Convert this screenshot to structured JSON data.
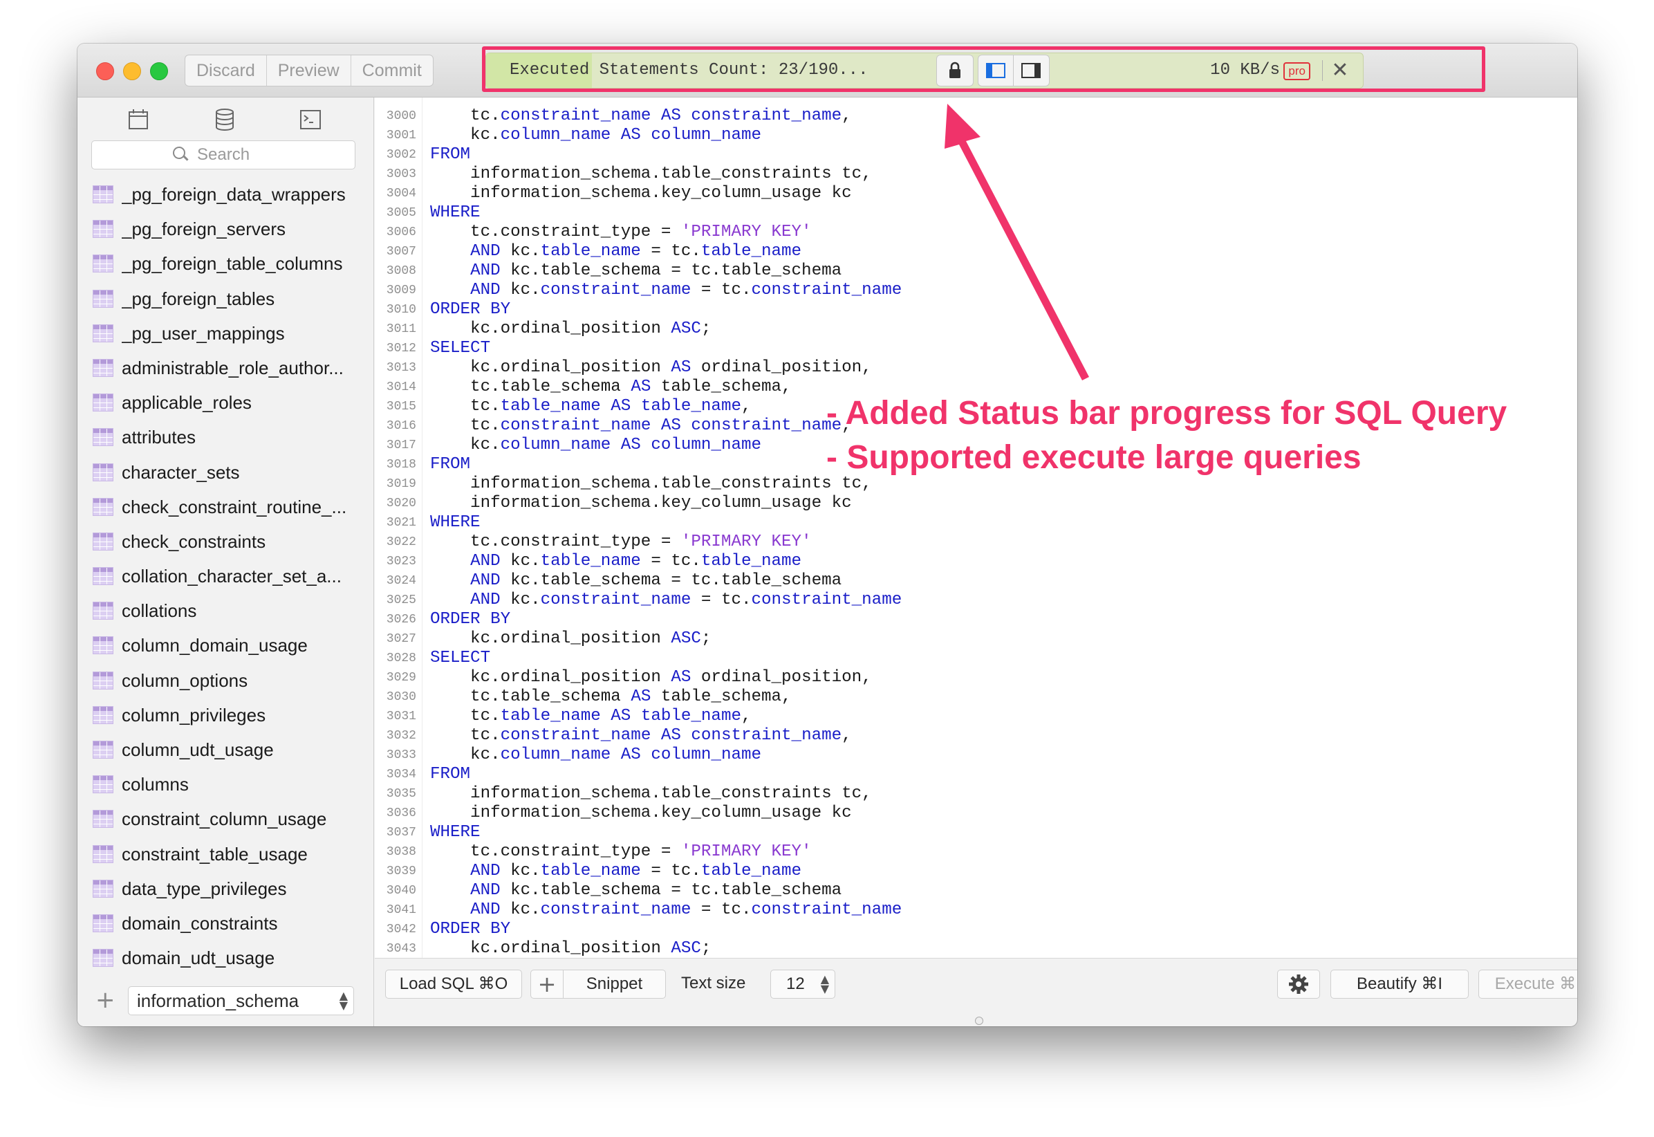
{
  "toolbar": {
    "discard_label": "Discard",
    "preview_label": "Preview",
    "commit_label": "Commit"
  },
  "status_bar": {
    "text": "Executed Statements Count: 23/190...",
    "speed": "10 KB/s",
    "badge": "pro",
    "progress_fraction": 0.121
  },
  "colors": {
    "close": "#fc5f57",
    "minimize": "#fdbc2e",
    "zoom": "#28c840",
    "annotation": "#f0336a",
    "keyword": "#1a1ec8",
    "string": "#8a3ad0"
  },
  "sidebar": {
    "search_placeholder": "Search",
    "tables": [
      "_pg_foreign_data_wrappers",
      "_pg_foreign_servers",
      "_pg_foreign_table_columns",
      "_pg_foreign_tables",
      "_pg_user_mappings",
      "administrable_role_author...",
      "applicable_roles",
      "attributes",
      "character_sets",
      "check_constraint_routine_...",
      "check_constraints",
      "collation_character_set_a...",
      "collations",
      "column_domain_usage",
      "column_options",
      "column_privileges",
      "column_udt_usage",
      "columns",
      "constraint_column_usage",
      "constraint_table_usage",
      "data_type_privileges",
      "domain_constraints",
      "domain_udt_usage"
    ],
    "add_symbol": "+",
    "schema": "information_schema"
  },
  "editor": {
    "lines": [
      {
        "n": "3000",
        "t": [
          [
            "    tc.",
            ""
          ],
          [
            "constraint_name",
            "fld"
          ],
          [
            " ",
            ""
          ],
          [
            "AS",
            "kw"
          ],
          [
            " ",
            ""
          ],
          [
            "constraint_name",
            "fld"
          ],
          [
            ",",
            ""
          ]
        ]
      },
      {
        "n": "3001",
        "t": [
          [
            "    kc.",
            ""
          ],
          [
            "column_name",
            "fld"
          ],
          [
            " ",
            ""
          ],
          [
            "AS",
            "kw"
          ],
          [
            " ",
            ""
          ],
          [
            "column_name",
            "fld"
          ]
        ]
      },
      {
        "n": "3002",
        "t": [
          [
            "FROM",
            "kw"
          ]
        ]
      },
      {
        "n": "3003",
        "t": [
          [
            "    information_schema.table_constraints tc,",
            ""
          ]
        ]
      },
      {
        "n": "3004",
        "t": [
          [
            "    information_schema.key_column_usage kc",
            ""
          ]
        ]
      },
      {
        "n": "3005",
        "t": [
          [
            "WHERE",
            "kw"
          ]
        ]
      },
      {
        "n": "3006",
        "t": [
          [
            "    tc.constraint_type = ",
            ""
          ],
          [
            "'PRIMARY KEY'",
            "str"
          ]
        ]
      },
      {
        "n": "3007",
        "t": [
          [
            "    ",
            ""
          ],
          [
            "AND",
            "kw"
          ],
          [
            " kc.",
            ""
          ],
          [
            "table_name",
            "fld"
          ],
          [
            " = tc.",
            ""
          ],
          [
            "table_name",
            "fld"
          ]
        ]
      },
      {
        "n": "3008",
        "t": [
          [
            "    ",
            ""
          ],
          [
            "AND",
            "kw"
          ],
          [
            " kc.table_schema = tc.table_schema",
            ""
          ]
        ]
      },
      {
        "n": "3009",
        "t": [
          [
            "    ",
            ""
          ],
          [
            "AND",
            "kw"
          ],
          [
            " kc.",
            ""
          ],
          [
            "constraint_name",
            "fld"
          ],
          [
            " = tc.",
            ""
          ],
          [
            "constraint_name",
            "fld"
          ]
        ]
      },
      {
        "n": "3010",
        "t": [
          [
            "ORDER BY",
            "kw"
          ]
        ]
      },
      {
        "n": "3011",
        "t": [
          [
            "    kc.ordinal_position ",
            ""
          ],
          [
            "ASC",
            "kw"
          ],
          [
            ";",
            ""
          ]
        ]
      },
      {
        "n": "3012",
        "t": [
          [
            "SELECT",
            "kw"
          ]
        ]
      },
      {
        "n": "3013",
        "t": [
          [
            "    kc.ordinal_position ",
            ""
          ],
          [
            "AS",
            "kw"
          ],
          [
            " ordinal_position,",
            ""
          ]
        ]
      },
      {
        "n": "3014",
        "t": [
          [
            "    tc.table_schema ",
            ""
          ],
          [
            "AS",
            "kw"
          ],
          [
            " table_schema,",
            ""
          ]
        ]
      },
      {
        "n": "3015",
        "t": [
          [
            "    tc.",
            ""
          ],
          [
            "table_name",
            "fld"
          ],
          [
            " ",
            ""
          ],
          [
            "AS",
            "kw"
          ],
          [
            " ",
            ""
          ],
          [
            "table_name",
            "fld"
          ],
          [
            ",",
            ""
          ]
        ]
      },
      {
        "n": "3016",
        "t": [
          [
            "    tc.",
            ""
          ],
          [
            "constraint_name",
            "fld"
          ],
          [
            " ",
            ""
          ],
          [
            "AS",
            "kw"
          ],
          [
            " ",
            ""
          ],
          [
            "constraint_name",
            "fld"
          ],
          [
            ",",
            ""
          ]
        ]
      },
      {
        "n": "3017",
        "t": [
          [
            "    kc.",
            ""
          ],
          [
            "column_name",
            "fld"
          ],
          [
            " ",
            ""
          ],
          [
            "AS",
            "kw"
          ],
          [
            " ",
            ""
          ],
          [
            "column_name",
            "fld"
          ]
        ]
      },
      {
        "n": "3018",
        "t": [
          [
            "FROM",
            "kw"
          ]
        ]
      },
      {
        "n": "3019",
        "t": [
          [
            "    information_schema.table_constraints tc,",
            ""
          ]
        ]
      },
      {
        "n": "3020",
        "t": [
          [
            "    information_schema.key_column_usage kc",
            ""
          ]
        ]
      },
      {
        "n": "3021",
        "t": [
          [
            "WHERE",
            "kw"
          ]
        ]
      },
      {
        "n": "3022",
        "t": [
          [
            "    tc.constraint_type = ",
            ""
          ],
          [
            "'PRIMARY KEY'",
            "str"
          ]
        ]
      },
      {
        "n": "3023",
        "t": [
          [
            "    ",
            ""
          ],
          [
            "AND",
            "kw"
          ],
          [
            " kc.",
            ""
          ],
          [
            "table_name",
            "fld"
          ],
          [
            " = tc.",
            ""
          ],
          [
            "table_name",
            "fld"
          ]
        ]
      },
      {
        "n": "3024",
        "t": [
          [
            "    ",
            ""
          ],
          [
            "AND",
            "kw"
          ],
          [
            " kc.table_schema = tc.table_schema",
            ""
          ]
        ]
      },
      {
        "n": "3025",
        "t": [
          [
            "    ",
            ""
          ],
          [
            "AND",
            "kw"
          ],
          [
            " kc.",
            ""
          ],
          [
            "constraint_name",
            "fld"
          ],
          [
            " = tc.",
            ""
          ],
          [
            "constraint_name",
            "fld"
          ]
        ]
      },
      {
        "n": "3026",
        "t": [
          [
            "ORDER BY",
            "kw"
          ]
        ]
      },
      {
        "n": "3027",
        "t": [
          [
            "    kc.ordinal_position ",
            ""
          ],
          [
            "ASC",
            "kw"
          ],
          [
            ";",
            ""
          ]
        ]
      },
      {
        "n": "3028",
        "t": [
          [
            "SELECT",
            "kw"
          ]
        ]
      },
      {
        "n": "3029",
        "t": [
          [
            "    kc.ordinal_position ",
            ""
          ],
          [
            "AS",
            "kw"
          ],
          [
            " ordinal_position,",
            ""
          ]
        ]
      },
      {
        "n": "3030",
        "t": [
          [
            "    tc.table_schema ",
            ""
          ],
          [
            "AS",
            "kw"
          ],
          [
            " table_schema,",
            ""
          ]
        ]
      },
      {
        "n": "3031",
        "t": [
          [
            "    tc.",
            ""
          ],
          [
            "table_name",
            "fld"
          ],
          [
            " ",
            ""
          ],
          [
            "AS",
            "kw"
          ],
          [
            " ",
            ""
          ],
          [
            "table_name",
            "fld"
          ],
          [
            ",",
            ""
          ]
        ]
      },
      {
        "n": "3032",
        "t": [
          [
            "    tc.",
            ""
          ],
          [
            "constraint_name",
            "fld"
          ],
          [
            " ",
            ""
          ],
          [
            "AS",
            "kw"
          ],
          [
            " ",
            ""
          ],
          [
            "constraint_name",
            "fld"
          ],
          [
            ",",
            ""
          ]
        ]
      },
      {
        "n": "3033",
        "t": [
          [
            "    kc.",
            ""
          ],
          [
            "column_name",
            "fld"
          ],
          [
            " ",
            ""
          ],
          [
            "AS",
            "kw"
          ],
          [
            " ",
            ""
          ],
          [
            "column_name",
            "fld"
          ]
        ]
      },
      {
        "n": "3034",
        "t": [
          [
            "FROM",
            "kw"
          ]
        ]
      },
      {
        "n": "3035",
        "t": [
          [
            "    information_schema.table_constraints tc,",
            ""
          ]
        ]
      },
      {
        "n": "3036",
        "t": [
          [
            "    information_schema.key_column_usage kc",
            ""
          ]
        ]
      },
      {
        "n": "3037",
        "t": [
          [
            "WHERE",
            "kw"
          ]
        ]
      },
      {
        "n": "3038",
        "t": [
          [
            "    tc.constraint_type = ",
            ""
          ],
          [
            "'PRIMARY KEY'",
            "str"
          ]
        ]
      },
      {
        "n": "3039",
        "t": [
          [
            "    ",
            ""
          ],
          [
            "AND",
            "kw"
          ],
          [
            " kc.",
            ""
          ],
          [
            "table_name",
            "fld"
          ],
          [
            " = tc.",
            ""
          ],
          [
            "table_name",
            "fld"
          ]
        ]
      },
      {
        "n": "3040",
        "t": [
          [
            "    ",
            ""
          ],
          [
            "AND",
            "kw"
          ],
          [
            " kc.table_schema = tc.table_schema",
            ""
          ]
        ]
      },
      {
        "n": "3041",
        "t": [
          [
            "    ",
            ""
          ],
          [
            "AND",
            "kw"
          ],
          [
            " kc.",
            ""
          ],
          [
            "constraint_name",
            "fld"
          ],
          [
            " = tc.",
            ""
          ],
          [
            "constraint_name",
            "fld"
          ]
        ]
      },
      {
        "n": "3042",
        "t": [
          [
            "ORDER BY",
            "kw"
          ]
        ]
      },
      {
        "n": "3043",
        "t": [
          [
            "    kc.ordinal_position ",
            ""
          ],
          [
            "ASC",
            "kw"
          ],
          [
            ";",
            ""
          ]
        ]
      }
    ]
  },
  "annotation": {
    "line1": "- Added Status bar progress for SQL Query",
    "line2": "- Supported execute large queries"
  },
  "bottom_bar": {
    "load_sql": "Load SQL ⌘O",
    "add_symbol": "+",
    "snippet": "Snippet",
    "text_size_label": "Text size",
    "text_size_value": "12",
    "beautify": "Beautify ⌘I",
    "execute": "Execute ⌘E"
  }
}
